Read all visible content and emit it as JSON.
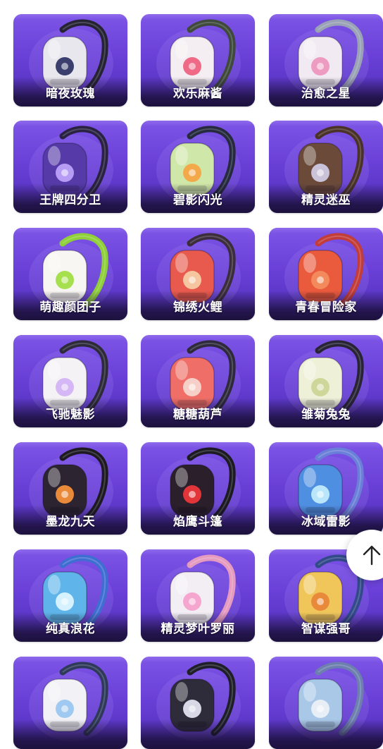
{
  "items": [
    {
      "name": "暗夜玫瑰",
      "bag": "#e9e7ee",
      "accent": "#3b3f6e",
      "strap": "#262334"
    },
    {
      "name": "欢乐麻酱",
      "bag": "#f4eef2",
      "accent": "#ef6a86",
      "strap": "#3f4a3c"
    },
    {
      "name": "治愈之星",
      "bag": "#f1eaf2",
      "accent": "#ee9bc2",
      "strap": "#9aa2b6"
    },
    {
      "name": "王牌四分卫",
      "bag": "#553aa8",
      "accent": "#b79cf5",
      "strap": "#2a2242"
    },
    {
      "name": "碧影闪光",
      "bag": "#cfe7a8",
      "accent": "#f3a94a",
      "strap": "#262a3e"
    },
    {
      "name": "精灵迷巫",
      "bag": "#6b4a3a",
      "accent": "#c9c2d8",
      "strap": "#4a3228"
    },
    {
      "name": "萌趣颜团子",
      "bag": "#f8f6f2",
      "accent": "#a6e04f",
      "strap": "#8fd03a"
    },
    {
      "name": "锦绣火鲤",
      "bag": "#e85a4d",
      "accent": "#f6c6a0",
      "strap": "#3c2d3c"
    },
    {
      "name": "青春冒险家",
      "bag": "#ea5a3c",
      "accent": "#f28a5c",
      "strap": "#c23c3a"
    },
    {
      "name": "飞驰魅影",
      "bag": "#f4f2f4",
      "accent": "#d6b7f5",
      "strap": "#2d2a3a"
    },
    {
      "name": "糖糖葫芦",
      "bag": "#ef6f68",
      "accent": "#f6d0c8",
      "strap": "#2e2a3c"
    },
    {
      "name": "雏菊兔兔",
      "bag": "#eef0d8",
      "accent": "#cfd69a",
      "strap": "#282436"
    },
    {
      "name": "墨龙九天",
      "bag": "#2c2430",
      "accent": "#e98a3a",
      "strap": "#1e1a22"
    },
    {
      "name": "焰鹰斗篷",
      "bag": "#2a1f2a",
      "accent": "#e2353a",
      "strap": "#1c1a22"
    },
    {
      "name": "冰域雷影",
      "bag": "#4f8fe2",
      "accent": "#b9e6fb",
      "strap": "#6a7fd8"
    },
    {
      "name": "纯真浪花",
      "bag": "#5fb5ea",
      "accent": "#d6f1ff",
      "strap": "#3f6ed2"
    },
    {
      "name": "精灵梦叶罗丽",
      "bag": "#f2eef4",
      "accent": "#f5a6cf",
      "strap": "#e59ac0"
    },
    {
      "name": "智谋强哥",
      "bag": "#f0c65a",
      "accent": "#e88a3a",
      "strap": "#324a8a"
    },
    {
      "name": "",
      "bag": "#f2f2f6",
      "accent": "#9fc9f0",
      "strap": "#2f3a5a"
    },
    {
      "name": "",
      "bag": "#2e2b3a",
      "accent": "#d8d8e6",
      "strap": "#1f1f2a"
    },
    {
      "name": "",
      "bag": "#a9c8e8",
      "accent": "#e8eef6",
      "strap": "#6d7fae"
    }
  ],
  "back_to_top_icon": "arrow-up-icon"
}
